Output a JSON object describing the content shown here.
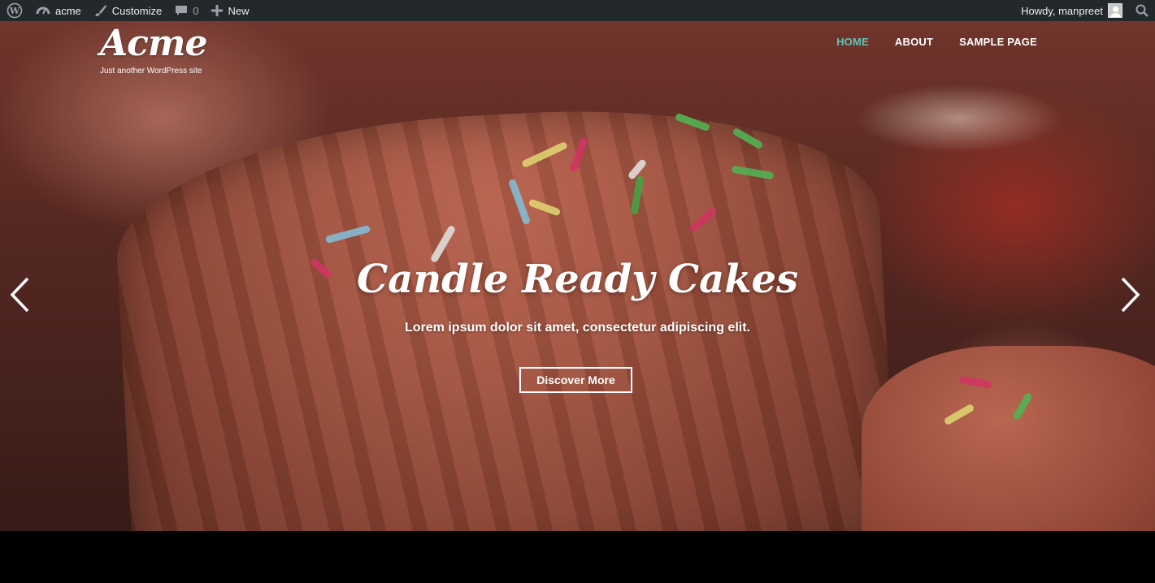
{
  "admin_bar": {
    "wp_logo_icon": "wordpress-icon",
    "site_icon": "dashboard-icon",
    "site_name": "acme",
    "customize_icon": "paintbrush-icon",
    "customize_label": "Customize",
    "comments_icon": "comment-bubble-icon",
    "comments_count": "0",
    "new_icon": "plus-icon",
    "new_label": "New",
    "greeting": "Howdy, manpreet",
    "search_icon": "search-icon",
    "background_color": "#23282d"
  },
  "site": {
    "logo": "Acme",
    "tagline": "Just another WordPress site"
  },
  "nav": {
    "items": [
      {
        "label": "HOME",
        "active": true
      },
      {
        "label": "ABOUT",
        "active": false
      },
      {
        "label": "SAMPLE PAGE",
        "active": false
      }
    ],
    "active_color": "#5ec6b4"
  },
  "slider": {
    "title": "Candle Ready Cakes",
    "description": "Lorem ipsum dolor sit amet, consectetur adipiscing elit.",
    "button_label": "Discover More",
    "prev_icon": "chevron-left-icon",
    "next_icon": "chevron-right-icon"
  }
}
